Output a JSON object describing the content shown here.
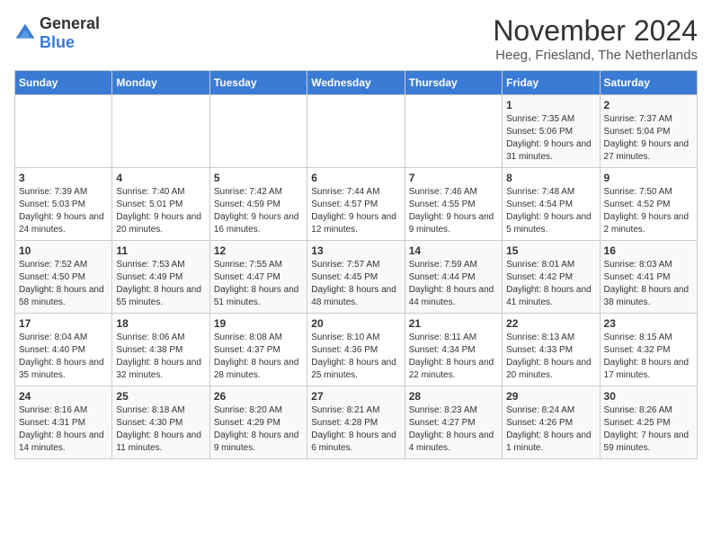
{
  "logo": {
    "general": "General",
    "blue": "Blue"
  },
  "title": "November 2024",
  "location": "Heeg, Friesland, The Netherlands",
  "days_of_week": [
    "Sunday",
    "Monday",
    "Tuesday",
    "Wednesday",
    "Thursday",
    "Friday",
    "Saturday"
  ],
  "weeks": [
    [
      {
        "day": "",
        "info": ""
      },
      {
        "day": "",
        "info": ""
      },
      {
        "day": "",
        "info": ""
      },
      {
        "day": "",
        "info": ""
      },
      {
        "day": "",
        "info": ""
      },
      {
        "day": "1",
        "info": "Sunrise: 7:35 AM\nSunset: 5:06 PM\nDaylight: 9 hours and 31 minutes."
      },
      {
        "day": "2",
        "info": "Sunrise: 7:37 AM\nSunset: 5:04 PM\nDaylight: 9 hours and 27 minutes."
      }
    ],
    [
      {
        "day": "3",
        "info": "Sunrise: 7:39 AM\nSunset: 5:03 PM\nDaylight: 9 hours and 24 minutes."
      },
      {
        "day": "4",
        "info": "Sunrise: 7:40 AM\nSunset: 5:01 PM\nDaylight: 9 hours and 20 minutes."
      },
      {
        "day": "5",
        "info": "Sunrise: 7:42 AM\nSunset: 4:59 PM\nDaylight: 9 hours and 16 minutes."
      },
      {
        "day": "6",
        "info": "Sunrise: 7:44 AM\nSunset: 4:57 PM\nDaylight: 9 hours and 12 minutes."
      },
      {
        "day": "7",
        "info": "Sunrise: 7:46 AM\nSunset: 4:55 PM\nDaylight: 9 hours and 9 minutes."
      },
      {
        "day": "8",
        "info": "Sunrise: 7:48 AM\nSunset: 4:54 PM\nDaylight: 9 hours and 5 minutes."
      },
      {
        "day": "9",
        "info": "Sunrise: 7:50 AM\nSunset: 4:52 PM\nDaylight: 9 hours and 2 minutes."
      }
    ],
    [
      {
        "day": "10",
        "info": "Sunrise: 7:52 AM\nSunset: 4:50 PM\nDaylight: 8 hours and 58 minutes."
      },
      {
        "day": "11",
        "info": "Sunrise: 7:53 AM\nSunset: 4:49 PM\nDaylight: 8 hours and 55 minutes."
      },
      {
        "day": "12",
        "info": "Sunrise: 7:55 AM\nSunset: 4:47 PM\nDaylight: 8 hours and 51 minutes."
      },
      {
        "day": "13",
        "info": "Sunrise: 7:57 AM\nSunset: 4:45 PM\nDaylight: 8 hours and 48 minutes."
      },
      {
        "day": "14",
        "info": "Sunrise: 7:59 AM\nSunset: 4:44 PM\nDaylight: 8 hours and 44 minutes."
      },
      {
        "day": "15",
        "info": "Sunrise: 8:01 AM\nSunset: 4:42 PM\nDaylight: 8 hours and 41 minutes."
      },
      {
        "day": "16",
        "info": "Sunrise: 8:03 AM\nSunset: 4:41 PM\nDaylight: 8 hours and 38 minutes."
      }
    ],
    [
      {
        "day": "17",
        "info": "Sunrise: 8:04 AM\nSunset: 4:40 PM\nDaylight: 8 hours and 35 minutes."
      },
      {
        "day": "18",
        "info": "Sunrise: 8:06 AM\nSunset: 4:38 PM\nDaylight: 8 hours and 32 minutes."
      },
      {
        "day": "19",
        "info": "Sunrise: 8:08 AM\nSunset: 4:37 PM\nDaylight: 8 hours and 28 minutes."
      },
      {
        "day": "20",
        "info": "Sunrise: 8:10 AM\nSunset: 4:36 PM\nDaylight: 8 hours and 25 minutes."
      },
      {
        "day": "21",
        "info": "Sunrise: 8:11 AM\nSunset: 4:34 PM\nDaylight: 8 hours and 22 minutes."
      },
      {
        "day": "22",
        "info": "Sunrise: 8:13 AM\nSunset: 4:33 PM\nDaylight: 8 hours and 20 minutes."
      },
      {
        "day": "23",
        "info": "Sunrise: 8:15 AM\nSunset: 4:32 PM\nDaylight: 8 hours and 17 minutes."
      }
    ],
    [
      {
        "day": "24",
        "info": "Sunrise: 8:16 AM\nSunset: 4:31 PM\nDaylight: 8 hours and 14 minutes."
      },
      {
        "day": "25",
        "info": "Sunrise: 8:18 AM\nSunset: 4:30 PM\nDaylight: 8 hours and 11 minutes."
      },
      {
        "day": "26",
        "info": "Sunrise: 8:20 AM\nSunset: 4:29 PM\nDaylight: 8 hours and 9 minutes."
      },
      {
        "day": "27",
        "info": "Sunrise: 8:21 AM\nSunset: 4:28 PM\nDaylight: 8 hours and 6 minutes."
      },
      {
        "day": "28",
        "info": "Sunrise: 8:23 AM\nSunset: 4:27 PM\nDaylight: 8 hours and 4 minutes."
      },
      {
        "day": "29",
        "info": "Sunrise: 8:24 AM\nSunset: 4:26 PM\nDaylight: 8 hours and 1 minute."
      },
      {
        "day": "30",
        "info": "Sunrise: 8:26 AM\nSunset: 4:25 PM\nDaylight: 7 hours and 59 minutes."
      }
    ]
  ]
}
